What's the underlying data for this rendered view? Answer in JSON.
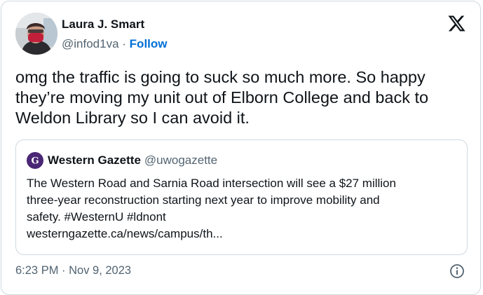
{
  "author": {
    "name": "Laura J. Smart",
    "handle": "@infod1va",
    "separator": "·",
    "follow_label": "Follow"
  },
  "brand_icon": "x-logo-icon",
  "tweet_text": "omg the traffic is going to suck so much more. So happy they’re moving my unit out of Elborn College and back to Weldon Library so I can avoid it.",
  "quoted": {
    "name": "Western Gazette",
    "handle": "@uwogazette",
    "logo_icon": "gazette-logo-icon",
    "lines": [
      "The Western Road and Sarnia Road intersection will see a $27 million",
      "three-year reconstruction starting next year to improve mobility and",
      "safety. #WesternU #ldnont",
      "westerngazette.ca/news/campus/th..."
    ]
  },
  "timestamp": "6:23 PM · Nov 9, 2023",
  "info_icon": "info-icon",
  "colors": {
    "follow": "#006fd6",
    "secondary_text": "#536471",
    "border": "#cfd9de",
    "gazette_logo": "#4a2775"
  }
}
